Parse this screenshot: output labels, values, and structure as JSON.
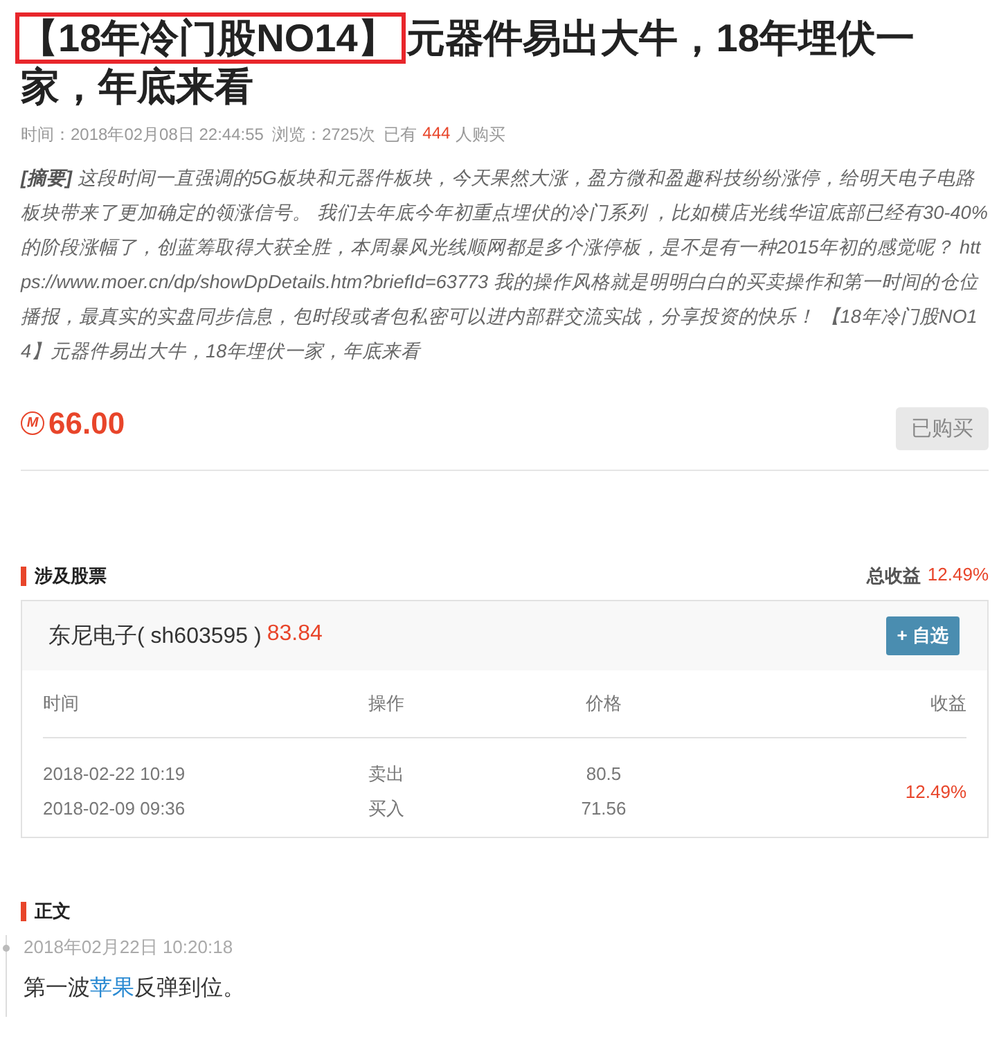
{
  "title": {
    "highlighted": "【18年冷门股NO14】",
    "rest": "元器件易出大牛，18年埋伏一家，年底来看"
  },
  "meta": {
    "time": "时间：2018年02月08日 22:44:55",
    "views": "浏览：2725次",
    "bought_prefix": "已有",
    "bought_count": "444",
    "bought_suffix": "人购买"
  },
  "summary": "**[摘要]** 这段时间一直强调的5G板块和元器件板块，今天果然大涨，盈方微和盈趣科技纷纷涨停，给明天电子电路板块带来了更加确定的领涨信号。 我们去年底今年初重点埋伏的冷门系列 ，比如横店光线华谊底部已经有30-40%的阶段涨幅了，创蓝筹取得大获全胜，本周暴风光线顺网都是多个涨停板，是不是有一种2015年初的感觉呢？ https://www.moer.cn/dp/showDpDetails.htm?briefId=63773 我的操作风格就是明明白白的买卖操作和第一时间的仓位播报，最真实的实盘同步信息，包时段或者包私密可以进内部群交流实战，分享投资的快乐！ 【18年冷门股NO14】元器件易出大牛，18年埋伏一家，年底来看",
  "price": {
    "currency_symbol": "M",
    "amount": "66.00",
    "button": "已购买",
    "purchased": true
  },
  "stocks": {
    "heading": "涉及股票",
    "total_label": "总收益",
    "total_value": "12.49%",
    "stock": {
      "name": "东尼电子( sh603595 )",
      "price": "83.84",
      "add_button": "+ 自选"
    },
    "columns": [
      "时间",
      "操作",
      "价格",
      "收益"
    ],
    "trades": [
      {
        "time": "2018-02-22 10:19",
        "action": "卖出",
        "price": "80.5"
      },
      {
        "time": "2018-02-09 09:36",
        "action": "买入",
        "price": "71.56"
      }
    ],
    "return": "12.49%"
  },
  "body": {
    "heading": "正文",
    "entries": [
      {
        "time": "2018年02月22日 10:20:18",
        "before": "第一波",
        "link": "苹果",
        "after": "反弹到位。"
      }
    ]
  }
}
